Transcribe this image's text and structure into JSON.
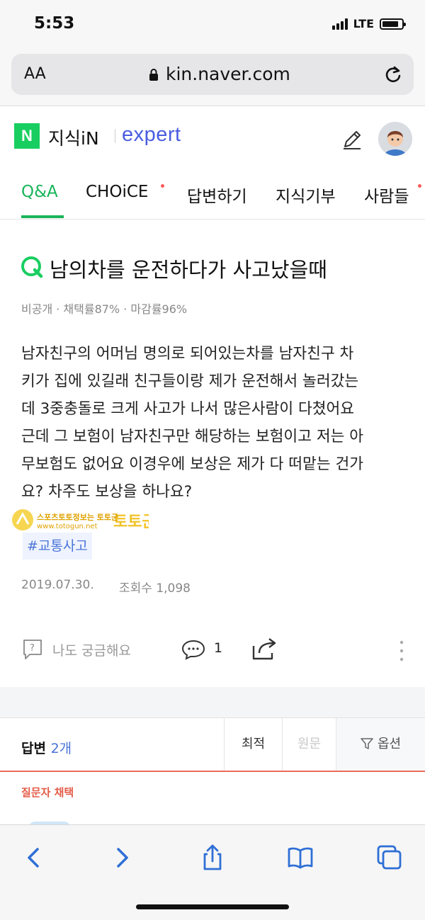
{
  "status_bar": {
    "time": "5:53",
    "network": "LTE",
    "battery_level": 0.85
  },
  "browser": {
    "text_size_label": "AA",
    "url": "kin.naver.com"
  },
  "header": {
    "logo_letter": "N",
    "service_name": "지식iN",
    "expert_label": "expert"
  },
  "tabs": [
    {
      "label": "Q&A",
      "active": true
    },
    {
      "label": "CHOiCE",
      "active": false,
      "dot": true
    },
    {
      "label": "답변하기",
      "active": false
    },
    {
      "label": "지식기부",
      "active": false
    },
    {
      "label": "사람들",
      "active": false,
      "dot": true
    }
  ],
  "question": {
    "title": "남의차를 운전하다가 사고났을때",
    "meta": "비공개 · 채택률87% · 마감률96%",
    "body_lines": [
      "남자친구의 어머님 명의로 되어있는차를 남자친구 차",
      "키가 집에 있길래 친구들이랑 제가 운전해서 놀러갔는",
      "데 3중충돌로 크게 사고가 나서 많은사람이 다쳤어요",
      "근데 그 보험이 남자친구만 해당하는 보험이고 저는 아",
      "무보험도 없어요 이경우에 보상은 제가 다 떠맡는 건가",
      "요? 차주도 보상을 하나요?"
    ],
    "hashtag": "#교통사고",
    "date": "2019.07.30.",
    "views": "조회수 1,098"
  },
  "watermark": {
    "text": "스포츠토토정보는 토토군",
    "url": "www.totogun.net"
  },
  "actions": {
    "curious_label": "나도 궁금해요",
    "comment_count": "1"
  },
  "answers": {
    "label": "답변",
    "count": "2개",
    "sort_best": "최적",
    "sort_original": "원문",
    "options": "옵션",
    "chosen_label": "질문자 채택"
  },
  "colors": {
    "naver_green": "#19ce60",
    "tab_active": "#19b55a",
    "expert_blue": "#4a5ce0",
    "accent_red": "#e35c47",
    "ios_blue": "#2f6fd6"
  }
}
